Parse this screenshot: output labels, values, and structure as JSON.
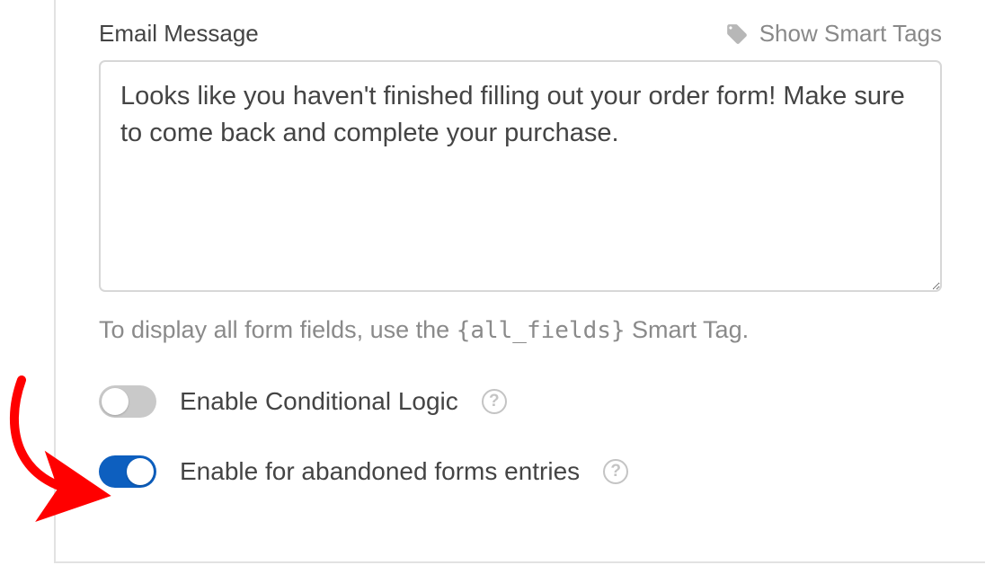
{
  "email_message": {
    "label": "Email Message",
    "smart_tags_link": "Show Smart Tags",
    "value": "Looks like you haven't finished filling out your order form! Make sure to come back and complete your purchase."
  },
  "hint": {
    "prefix": "To display all form fields, use the ",
    "code": "{all_fields}",
    "suffix": " Smart Tag."
  },
  "toggles": {
    "conditional_logic": {
      "label": "Enable Conditional Logic",
      "enabled": false
    },
    "abandoned_forms": {
      "label": "Enable for abandoned forms entries",
      "enabled": true
    }
  }
}
